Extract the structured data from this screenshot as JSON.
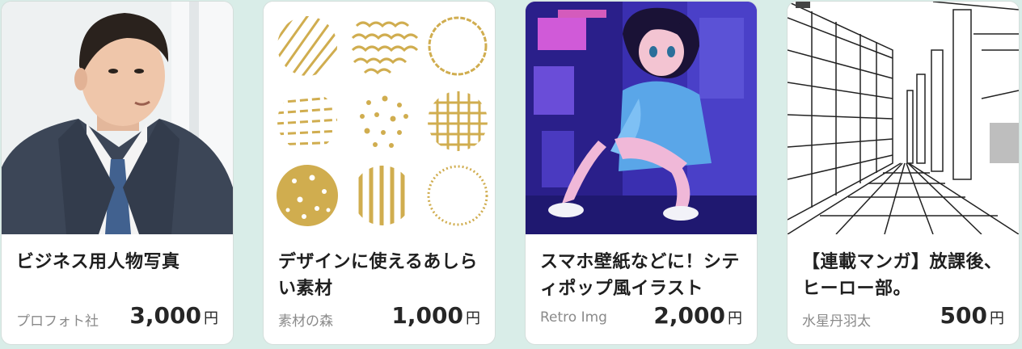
{
  "products": [
    {
      "title": "ビジネス用人物写真",
      "author": "プロフォト社",
      "price": "3,000",
      "currency": "円",
      "thumbnail": "business-portrait"
    },
    {
      "title": "デザインに使えるあしらい素材",
      "author": "素材の森",
      "price": "1,000",
      "currency": "円",
      "thumbnail": "gold-pattern-circles"
    },
    {
      "title": "スマホ壁紙などに！シティポップ風イラスト",
      "author": "Retro Img",
      "price": "2,000",
      "currency": "円",
      "thumbnail": "citypop-anime-girl"
    },
    {
      "title": "【連載マンガ】放課後、ヒーロー部。",
      "author": "水星丹羽太",
      "price": "500",
      "currency": "円",
      "thumbnail": "manga-street-lineart"
    }
  ]
}
